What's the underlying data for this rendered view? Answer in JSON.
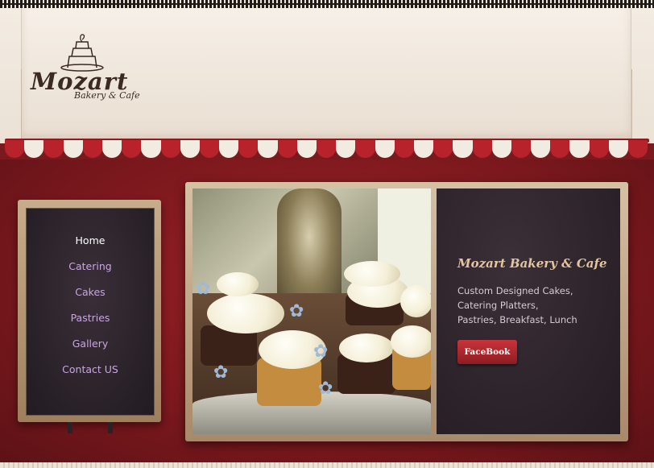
{
  "logo": {
    "name": "Mozart",
    "tagline": "Bakery & Cafe"
  },
  "nav": {
    "items": [
      {
        "label": "Home",
        "active": true
      },
      {
        "label": "Catering"
      },
      {
        "label": "Cakes"
      },
      {
        "label": "Pastries"
      },
      {
        "label": "Gallery"
      },
      {
        "label": "Contact US"
      }
    ]
  },
  "hero": {
    "title": "Mozart Bakery & Cafe",
    "description": "Custom Designed Cakes,\nCatering Platters,\nPastries, Breakfast, Lunch",
    "facebook_label": "FaceBook"
  },
  "colors": {
    "awning_red": "#b8222b",
    "background_red": "#7a181d",
    "nav_text": "#c9a6df",
    "title_gold": "#e3c69f"
  }
}
